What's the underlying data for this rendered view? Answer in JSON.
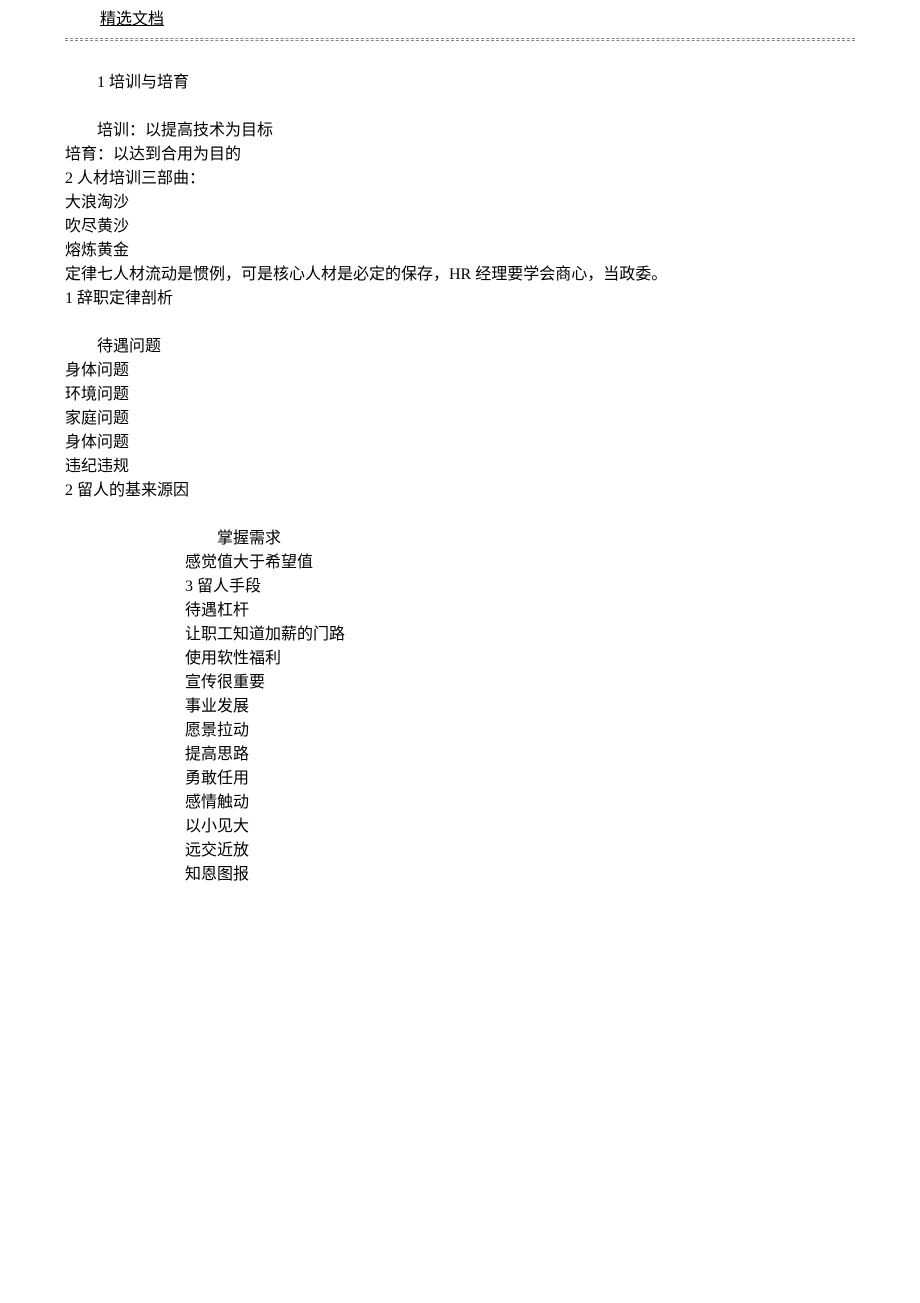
{
  "header": {
    "title": "精选文档"
  },
  "section1": {
    "heading": "1 培训与培育",
    "lines": [
      "培训：以提高技术为目标",
      "培育：以达到合用为目的",
      "2 人材培训三部曲：",
      "大浪淘沙",
      "吹尽黄沙",
      "熔炼黄金",
      "定律七人材流动是惯例，可是核心人材是必定的保存，HR 经理要学会商心，当政委。",
      "1 辞职定律剖析"
    ]
  },
  "section2": {
    "heading": "待遇问题",
    "lines": [
      "身体问题",
      "环境问题",
      "家庭问题",
      "身体问题",
      "违纪违规",
      "2 留人的基来源因"
    ]
  },
  "section3": {
    "heading": "掌握需求",
    "lines": [
      "感觉值大于希望值",
      "3 留人手段",
      "待遇杠杆",
      "让职工知道加薪的门路",
      "使用软性福利",
      "宣传很重要",
      "事业发展",
      "愿景拉动",
      "提高思路",
      "勇敢任用",
      "感情触动",
      "以小见大",
      "远交近放",
      "知恩图报"
    ]
  }
}
